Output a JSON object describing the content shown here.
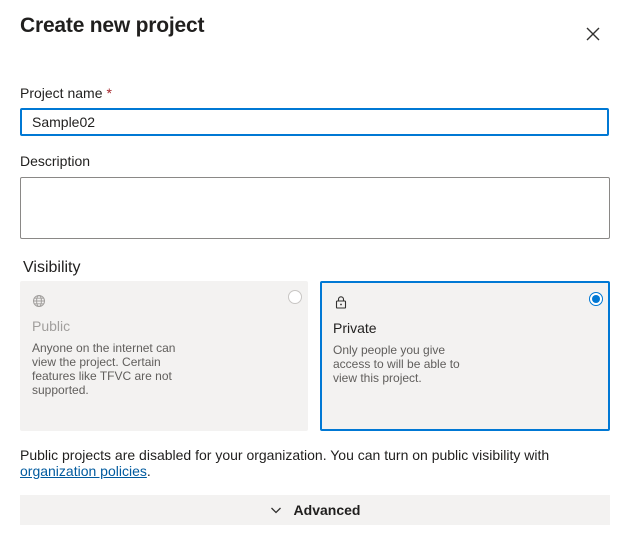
{
  "dialog": {
    "title": "Create new project"
  },
  "form": {
    "project_name_label": "Project name",
    "required_marker": "*",
    "project_name_value": "Sample02",
    "description_label": "Description",
    "description_value": ""
  },
  "visibility": {
    "heading": "Visibility",
    "options": [
      {
        "icon": "globe-icon",
        "title": "Public",
        "description": "Anyone on the internet can view the project. Certain features like TFVC are not supported.",
        "selected": false,
        "disabled": true
      },
      {
        "icon": "lock-icon",
        "title": "Private",
        "description": "Only people you give access to will be able to view this project.",
        "selected": true,
        "disabled": false
      }
    ],
    "note_text": "Public projects are disabled for your organization. You can turn on public visibility with",
    "note_link": "organization policies",
    "note_end": "."
  },
  "advanced": {
    "label": "Advanced"
  },
  "colors": {
    "accent": "#0078d4",
    "link": "#005a9e",
    "required": "#a4262c",
    "card_bg": "#f3f2f1"
  }
}
